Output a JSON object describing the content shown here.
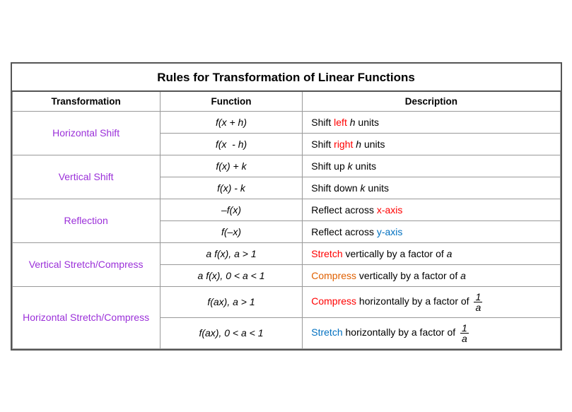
{
  "title": "Rules for Transformation of Linear Functions",
  "headers": {
    "transformation": "Transformation",
    "function": "Function",
    "description": "Description"
  },
  "rows": [
    {
      "transform": "Horizontal Shift",
      "transform_span": 2,
      "function": "f(x + h)",
      "description_parts": [
        {
          "text": "Shift ",
          "color": ""
        },
        {
          "text": "left",
          "color": "red"
        },
        {
          "text": " h units",
          "color": ""
        }
      ]
    },
    {
      "function": "f(x  - h)",
      "description_parts": [
        {
          "text": "Shift ",
          "color": ""
        },
        {
          "text": "right",
          "color": "red"
        },
        {
          "text": " h units",
          "color": ""
        }
      ]
    },
    {
      "transform": "Vertical Shift",
      "transform_span": 2,
      "function": "f(x) + k",
      "description_parts": [
        {
          "text": "Shift ",
          "color": ""
        },
        {
          "text": "up",
          "color": ""
        },
        {
          "text": " k units",
          "color": ""
        }
      ]
    },
    {
      "function": "f(x) - k",
      "description_parts": [
        {
          "text": "Shift ",
          "color": ""
        },
        {
          "text": "down",
          "color": ""
        },
        {
          "text": " k units",
          "color": ""
        }
      ]
    },
    {
      "transform": "Reflection",
      "transform_span": 2,
      "function": "–f(x)",
      "description_parts": [
        {
          "text": "Reflect across ",
          "color": ""
        },
        {
          "text": "x-axis",
          "color": "red"
        }
      ]
    },
    {
      "function": "f(–x)",
      "description_parts": [
        {
          "text": "Reflect across ",
          "color": ""
        },
        {
          "text": "y-axis",
          "color": "blue"
        }
      ]
    },
    {
      "transform": "Vertical Stretch/Compress",
      "transform_span": 2,
      "function": "a f(x), a > 1",
      "description_parts": [
        {
          "text": "Stretch",
          "color": "red"
        },
        {
          "text": " vertically by a factor of ",
          "color": ""
        },
        {
          "text": "a",
          "color": "",
          "italic": true
        }
      ]
    },
    {
      "function": "a f(x), 0 < a < 1",
      "description_parts": [
        {
          "text": "Compress",
          "color": "orange"
        },
        {
          "text": " vertically by a factor of ",
          "color": ""
        },
        {
          "text": "a",
          "color": "",
          "italic": true
        }
      ]
    },
    {
      "transform": "Horizontal Stretch/Compress",
      "transform_span": 2,
      "function": "f(ax), a > 1",
      "description_has_fraction": true,
      "description_parts": [
        {
          "text": "Compress",
          "color": "red"
        },
        {
          "text": " horizontally by a factor of ",
          "color": ""
        },
        {
          "text": "FRACTION_1_A",
          "color": ""
        }
      ]
    },
    {
      "function": "f(ax), 0 < a < 1",
      "description_has_fraction": true,
      "description_parts": [
        {
          "text": "Stretch",
          "color": "blue"
        },
        {
          "text": " horizontally by a factor of ",
          "color": ""
        },
        {
          "text": "FRACTION_1_A",
          "color": ""
        }
      ]
    }
  ]
}
